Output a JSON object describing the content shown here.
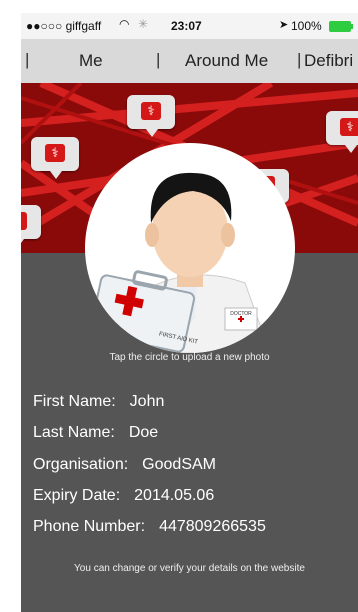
{
  "status_bar": {
    "carrier": "●●○○○ giffgaff",
    "time": "23:07",
    "battery": "100%"
  },
  "tabs": [
    {
      "label": "Me"
    },
    {
      "label": "Around Me"
    },
    {
      "label": "Defibri"
    }
  ],
  "avatar": {
    "kit_label": "FIRST AID KIT",
    "badge_label": "DOCTOR",
    "hint": "Tap the circle to upload a new photo"
  },
  "profile": {
    "first_name": {
      "label": "First Name:",
      "value": "John"
    },
    "last_name": {
      "label": "Last Name:",
      "value": "Doe"
    },
    "organisation": {
      "label": "Organisation:",
      "value": "GoodSAM"
    },
    "expiry_date": {
      "label": "Expiry Date:",
      "value": "2014.05.06"
    },
    "phone_number": {
      "label": "Phone Number:",
      "value": "447809266535"
    }
  },
  "footer_note": "You can change or verify your details on the website",
  "colors": {
    "banner": "#8a0a0a",
    "panel": "#555555",
    "tabs": "#d9d9d9"
  },
  "icons": [
    "wifi-icon",
    "location-arrow-icon",
    "battery-icon",
    "first-aid-marker-icon",
    "doctor-avatar-icon"
  ]
}
